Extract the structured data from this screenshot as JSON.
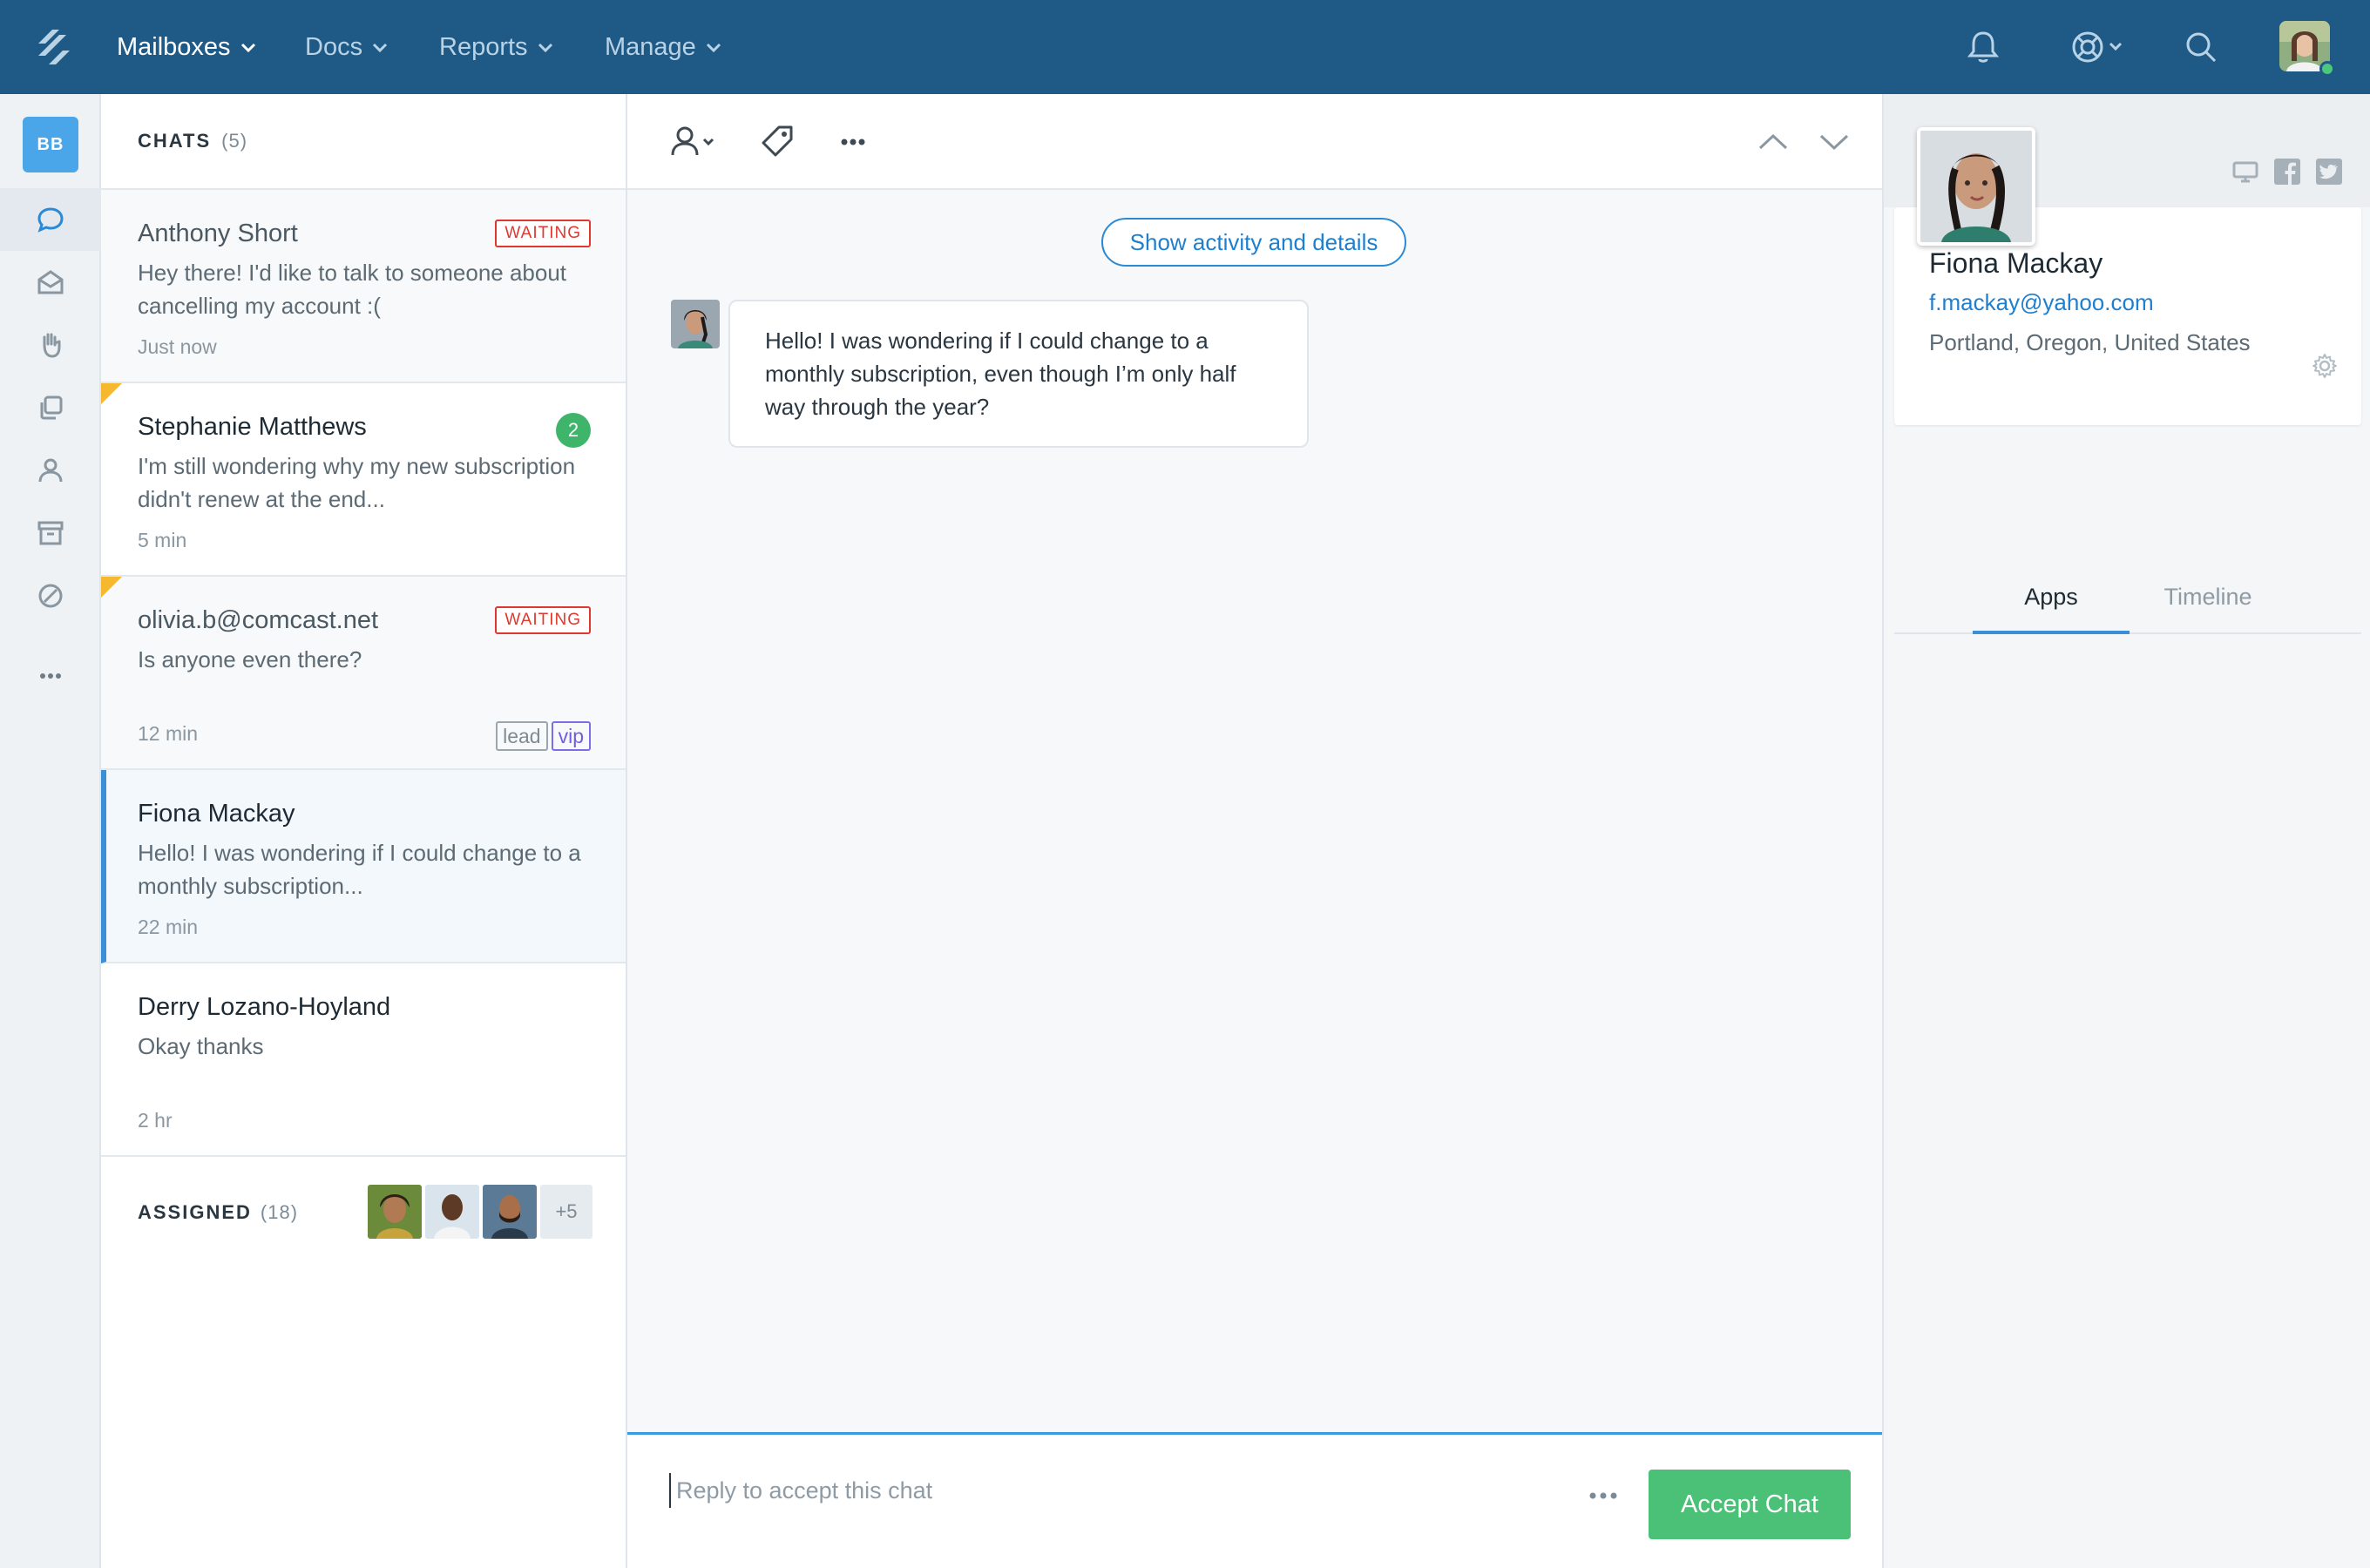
{
  "nav": {
    "items": [
      {
        "label": "Mailboxes",
        "active": true
      },
      {
        "label": "Docs",
        "active": false
      },
      {
        "label": "Reports",
        "active": false
      },
      {
        "label": "Manage",
        "active": false
      }
    ]
  },
  "rail": {
    "badge": "BB"
  },
  "chats": {
    "title": "CHATS",
    "count": "(5)",
    "items": [
      {
        "name": "Anthony Short",
        "preview": "Hey there! I'd like to talk to someone about cancelling my account :(",
        "time": "Just now",
        "status": "WAITING"
      },
      {
        "name": "Stephanie Matthews",
        "preview": "I'm still wondering why my new subscription didn't renew at the end...",
        "time": "5 min",
        "badge": "2"
      },
      {
        "name": "olivia.b@comcast.net",
        "preview": "Is anyone even there?",
        "time": "12 min",
        "status": "WAITING",
        "tags": [
          "lead",
          "vip"
        ]
      },
      {
        "name": "Fiona Mackay",
        "preview": "Hello! I was wondering if I could change to a monthly subscription...",
        "time": "22 min"
      },
      {
        "name": "Derry Lozano-Hoyland",
        "preview": "Okay thanks",
        "time": "2 hr"
      }
    ],
    "assigned": {
      "label": "ASSIGNED",
      "count": "(18)",
      "more": "+5"
    }
  },
  "conversation": {
    "activity_button": "Show activity and details",
    "message": "Hello! I was wondering if I could change to a monthly subscription, even though I’m only half way through the year?",
    "reply_placeholder": "Reply to accept this chat",
    "accept_label": "Accept Chat"
  },
  "profile": {
    "name": "Fiona Mackay",
    "email": "f.mackay@yahoo.com",
    "location": "Portland, Oregon, United States",
    "tabs": [
      "Apps",
      "Timeline"
    ]
  },
  "colors": {
    "nav_bg": "#1f5a87",
    "accent": "#3a8fd6",
    "accept": "#4bc077",
    "waiting": "#e0382f",
    "badge_green": "#3fb56c"
  }
}
